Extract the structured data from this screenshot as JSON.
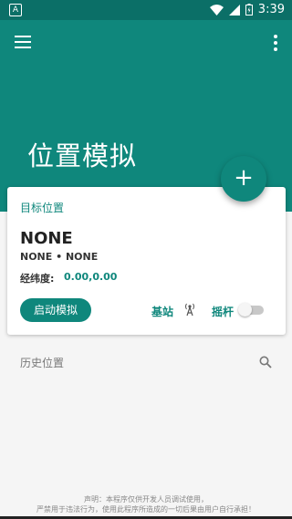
{
  "status_bar": {
    "time": "3:39",
    "app_badge": "A"
  },
  "header": {
    "title": "位置模拟",
    "bg_color": "#0f877c",
    "fab_label": "+"
  },
  "target_card": {
    "label": "目标位置",
    "name": "NONE",
    "sub": "NONE • NONE",
    "coord_label": "经纬度:",
    "coord_value": "0.00,0.00",
    "start_button": "启动模拟",
    "station_label": "基站",
    "joystick_label": "摇杆",
    "joystick_enabled": false
  },
  "history": {
    "label": "历史位置"
  },
  "disclaimer": {
    "line1": "声明：本程序仅供开发人员调试使用，",
    "line2": "严禁用于违法行为，使用此程序所造成的一切后果由用户自行承担！"
  },
  "icons": [
    "menu-icon",
    "more-icon",
    "wifi-icon",
    "signal-icon",
    "battery-icon",
    "add-icon",
    "antenna-icon",
    "search-icon"
  ]
}
